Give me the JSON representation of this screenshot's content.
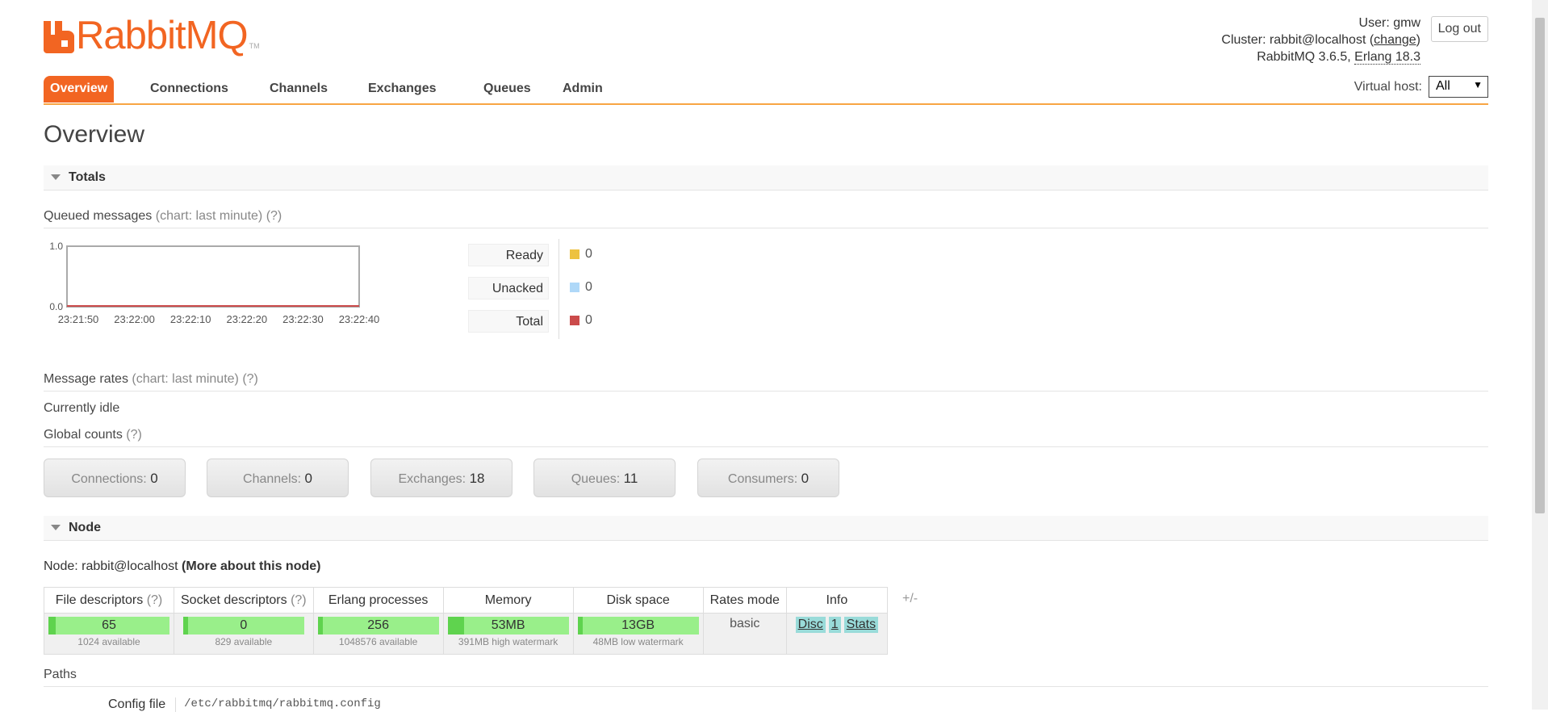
{
  "brand": {
    "name": "RabbitMQ",
    "tm": "TM",
    "color": "#f26522"
  },
  "header": {
    "user_label": "User:",
    "user": "gmw",
    "cluster_label": "Cluster:",
    "cluster": "rabbit@localhost",
    "change_link": "change",
    "version": "RabbitMQ 3.6.5,",
    "erlang": "Erlang 18.3",
    "logout": "Log out"
  },
  "nav": {
    "tabs": [
      "Overview",
      "Connections",
      "Channels",
      "Exchanges",
      "Queues",
      "Admin"
    ],
    "active": "Overview"
  },
  "vhost": {
    "label": "Virtual host:",
    "value": "All"
  },
  "page_title": "Overview",
  "totals": {
    "section": "Totals",
    "queued_title": "Queued messages",
    "queued_hint": "(chart: last minute) (?)",
    "chart_data": {
      "type": "line",
      "x": [
        "23:21:50",
        "23:22:00",
        "23:22:10",
        "23:22:20",
        "23:22:30",
        "23:22:40"
      ],
      "ylim": [
        0.0,
        1.0
      ],
      "yticks": [
        "1.0",
        "0.0"
      ],
      "series": [
        {
          "name": "Ready",
          "values": [
            0,
            0,
            0,
            0,
            0,
            0
          ],
          "color": "#edc240"
        },
        {
          "name": "Unacked",
          "values": [
            0,
            0,
            0,
            0,
            0,
            0
          ],
          "color": "#afd8f8"
        },
        {
          "name": "Total",
          "values": [
            0,
            0,
            0,
            0,
            0,
            0
          ],
          "color": "#cb4b4b"
        }
      ]
    },
    "legend": [
      {
        "label": "Ready",
        "value": "0",
        "color": "#edc240"
      },
      {
        "label": "Unacked",
        "value": "0",
        "color": "#afd8f8"
      },
      {
        "label": "Total",
        "value": "0",
        "color": "#cb4b4b"
      }
    ],
    "rates_title": "Message rates",
    "rates_hint": "(chart: last minute) (?)",
    "idle": "Currently idle",
    "global_title": "Global counts",
    "global_hint": "(?)",
    "counts": [
      {
        "label": "Connections:",
        "value": "0"
      },
      {
        "label": "Channels:",
        "value": "0"
      },
      {
        "label": "Exchanges:",
        "value": "18"
      },
      {
        "label": "Queues:",
        "value": "11"
      },
      {
        "label": "Consumers:",
        "value": "0"
      }
    ]
  },
  "node": {
    "section": "Node",
    "node_label": "Node:",
    "node_name": "rabbit@localhost",
    "more": "(More about this node)",
    "headers": {
      "fd": "File descriptors",
      "fd_hint": "(?)",
      "sd": "Socket descriptors",
      "sd_hint": "(?)",
      "ep": "Erlang processes",
      "mem": "Memory",
      "disk": "Disk space",
      "rates": "Rates mode",
      "info": "Info"
    },
    "fd": {
      "value": "65",
      "sub": "1024 available",
      "fraction": 0.063
    },
    "sd": {
      "value": "0",
      "sub": "829 available",
      "fraction": 0.0
    },
    "ep": {
      "value": "256",
      "sub": "1048576 available",
      "fraction": 0.0
    },
    "mem": {
      "value": "53MB",
      "sub": "391MB high watermark",
      "fraction": 0.136
    },
    "disk": {
      "value": "13GB",
      "sub": "48MB low watermark",
      "fraction": 0.0
    },
    "rates_mode": "basic",
    "info_tags": [
      "Disc",
      "1",
      "Stats"
    ],
    "plusminus": "+/-"
  },
  "paths": {
    "title": "Paths",
    "config_label": "Config file",
    "config_value": "/etc/rabbitmq/rabbitmq.config"
  }
}
